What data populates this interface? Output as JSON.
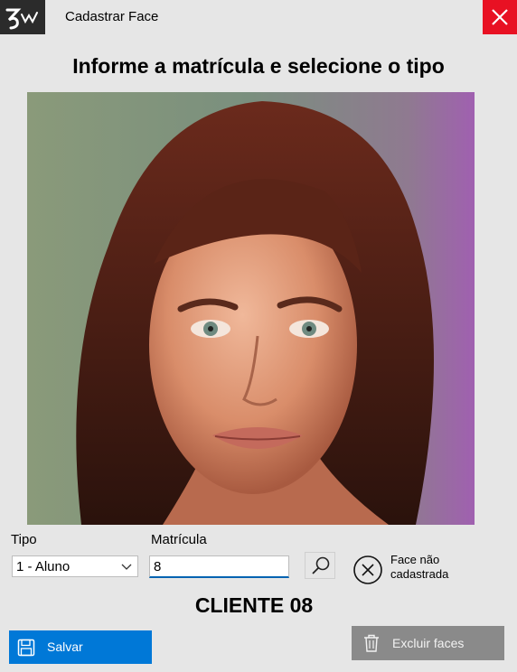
{
  "window": {
    "title": "Cadastrar Face",
    "logo_text": "Zw"
  },
  "heading": "Informe a matrícula e selecione o tipo",
  "form": {
    "tipo_label": "Tipo",
    "tipo_value": "1 - Aluno",
    "matricula_label": "Matrícula",
    "matricula_value": "8"
  },
  "status": {
    "text_line1": "Face não",
    "text_line2": "cadastrada",
    "icon": "x-circle-icon"
  },
  "client_name": "CLIENTE 08",
  "buttons": {
    "save_label": "Salvar",
    "delete_label": "Excluir faces"
  },
  "colors": {
    "close": "#e81123",
    "save": "#0078d7",
    "delete": "#8a8a8a",
    "background": "#e6e6e6"
  }
}
